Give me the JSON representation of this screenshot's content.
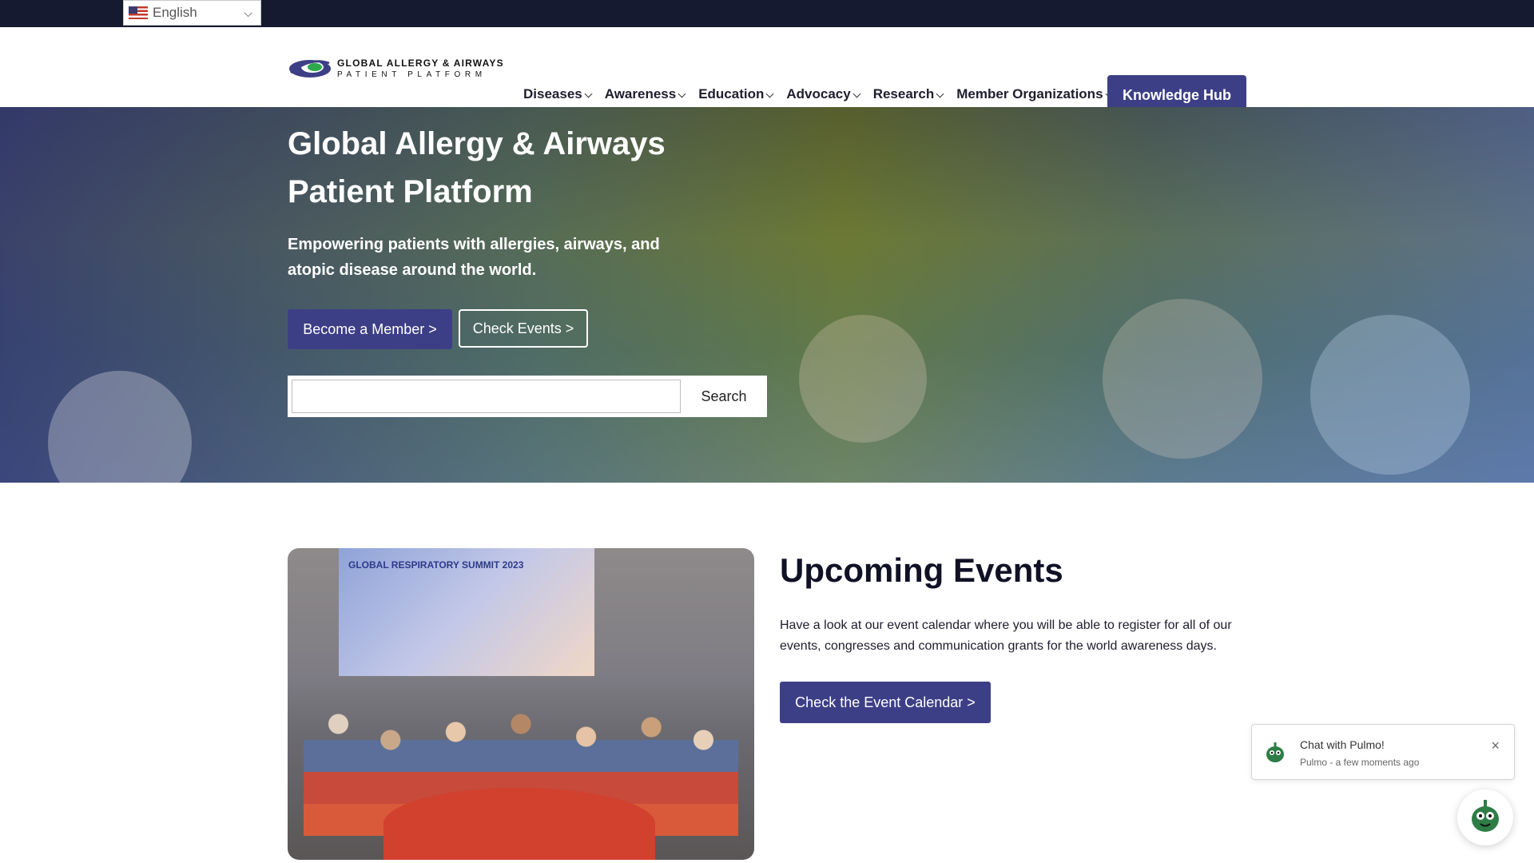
{
  "topbar": {
    "language": {
      "selected": "English",
      "flag_icon": "us-flag-icon"
    }
  },
  "header": {
    "logo": {
      "line1": "GLOBAL ALLERGY & AIRWAYS",
      "line2": "PATIENT PLATFORM"
    },
    "nav": [
      {
        "label": "Diseases"
      },
      {
        "label": "Awareness"
      },
      {
        "label": "Education"
      },
      {
        "label": "Advocacy"
      },
      {
        "label": "Research"
      },
      {
        "label": "Member Organizations"
      }
    ],
    "knowledge_hub": "Knowledge Hub"
  },
  "hero": {
    "title": "Global Allergy & Airways Patient Platform",
    "subtitle": "Empowering patients with allergies, airways, and atopic disease around the world.",
    "become_member": "Become a Member >",
    "check_events": "Check Events >",
    "search": {
      "value": "",
      "button": "Search"
    }
  },
  "events": {
    "title": "Upcoming Events",
    "description": "Have a look at our event calendar where you will be able to register for all of our events, congresses and communication grants for the world awareness days.",
    "button": "Check the Event Calendar >",
    "photo_screen_text": "GLOBAL RESPIRATORY SUMMIT 2023"
  },
  "chat": {
    "title": "Chat with Pulmo!",
    "subtitle": "Pulmo - a few moments ago",
    "close": "×"
  },
  "colors": {
    "accent": "#3d3f86",
    "topbar": "#161a30"
  }
}
